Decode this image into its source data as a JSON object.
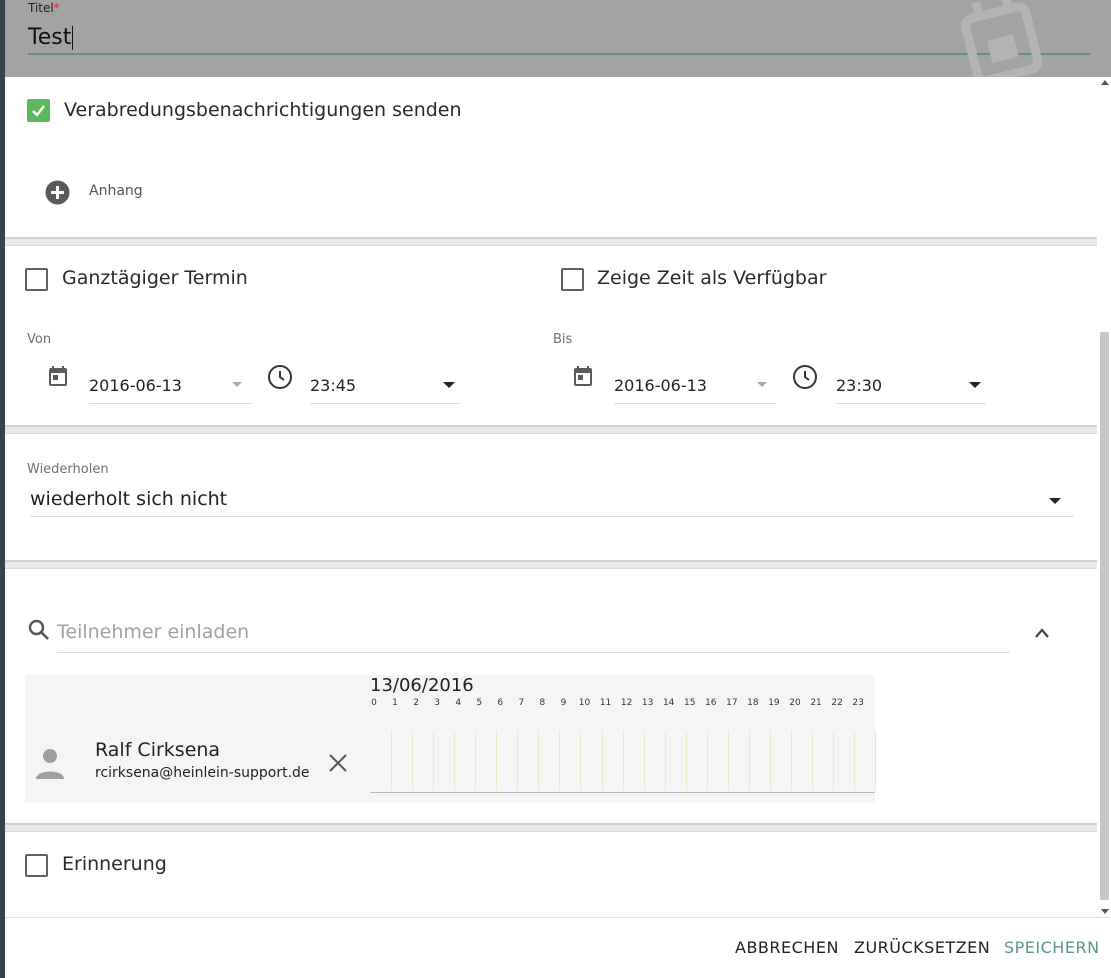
{
  "header": {
    "title_label": "Titel",
    "required_mark": "*",
    "title_value": "Test"
  },
  "notifications": {
    "label": "Verabredungsbenachrichtigungen senden",
    "checked": true
  },
  "attachment": {
    "label": "Anhang"
  },
  "all_day": {
    "label": "Ganztägiger Termin",
    "checked": false
  },
  "show_free": {
    "label": "Zeige Zeit als Verfügbar",
    "checked": false
  },
  "from": {
    "label": "Von",
    "date": "2016-06-13",
    "time": "23:45"
  },
  "to": {
    "label": "Bis",
    "date": "2016-06-13",
    "time": "23:30"
  },
  "repeat": {
    "label": "Wiederholen",
    "value": "wiederholt sich nicht"
  },
  "invite": {
    "placeholder": "Teilnehmer einladen"
  },
  "timeline": {
    "date": "13/06/2016",
    "hours": [
      "0",
      "1",
      "2",
      "3",
      "4",
      "5",
      "6",
      "7",
      "8",
      "9",
      "10",
      "11",
      "12",
      "13",
      "14",
      "15",
      "16",
      "17",
      "18",
      "19",
      "20",
      "21",
      "22",
      "23"
    ]
  },
  "attendee": {
    "name": "Ralf Cirksena",
    "email": "rcirksena@heinlein-support.de"
  },
  "reminder": {
    "label": "Erinnerung",
    "checked": false
  },
  "footer": {
    "cancel": "ABBRECHEN",
    "reset": "ZURÜCKSETZEN",
    "save": "SPEICHERN"
  },
  "colors": {
    "accent": "#5a958f",
    "check_green": "#5cb85c",
    "header_bg": "#a3a3a3"
  }
}
